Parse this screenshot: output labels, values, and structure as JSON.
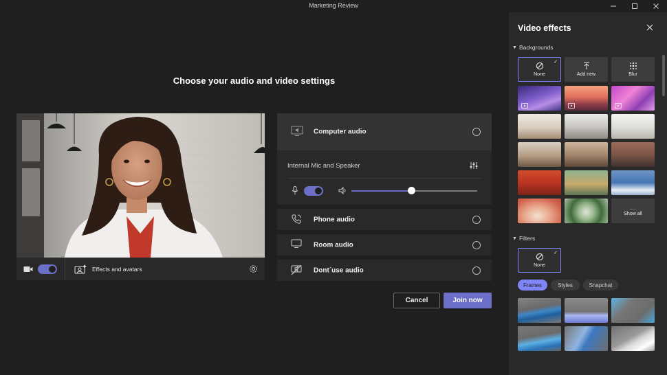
{
  "window": {
    "title": "Marketing Review"
  },
  "main": {
    "heading": "Choose your audio and video settings"
  },
  "video_controls": {
    "effects_label": "Effects and avatars",
    "camera_on": true
  },
  "audio": {
    "computer_audio_label": "Computer audio",
    "device_label": "Internal Mic and Speaker",
    "mic_on": true,
    "volume": 0.48,
    "options": [
      {
        "label": "Phone audio",
        "icon": "phone-icon"
      },
      {
        "label": "Room audio",
        "icon": "monitor-icon"
      },
      {
        "label": "Dont´use audio",
        "icon": "no-audio-icon"
      }
    ]
  },
  "actions": {
    "cancel_label": "Cancel",
    "join_label": "Join now"
  },
  "effects_panel": {
    "title": "Video effects",
    "backgrounds_label": "Backgrounds",
    "none_label": "None",
    "add_new_label": "Add new",
    "blur_label": "Blur",
    "show_all_label": "Show all",
    "filters_label": "Filters",
    "filter_none_label": "None",
    "filter_tabs": [
      "Frames",
      "Styles",
      "Snapchat"
    ]
  },
  "colors": {
    "accent": "#6b6fc7",
    "accent_light": "#7f85f5",
    "background": "#1f1f1f",
    "panel": "#292929"
  }
}
